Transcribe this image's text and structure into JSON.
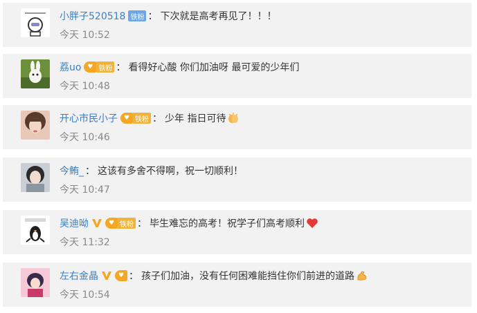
{
  "comments": [
    {
      "name": "小胖子520518",
      "badge_label": "铁粉",
      "badge_style": "blue",
      "text": "下次就是高考再见了！！！",
      "time": "今天 10:52"
    },
    {
      "name": "荔uo",
      "badge_label": "铁粉",
      "badge_style": "gold",
      "text": "看得好心酸 你们加油呀 最可爱的少年们",
      "time": "今天 10:48"
    },
    {
      "name": "开心市民小子",
      "badge_label": "铁粉",
      "badge_style": "gold",
      "text": "少年 指日可待",
      "emoji": "clap-hands-emoji",
      "time": "今天 10:46"
    },
    {
      "name": "今鲔_",
      "text": "这该有多舍不得啊，祝一切顺利！",
      "time": "今天 10:47"
    },
    {
      "name": "吴迪呦",
      "verified": true,
      "badge_label": "铁粉",
      "badge_style": "gold",
      "text": "毕生难忘的高考！祝学子们高考顺利",
      "emoji": "red-heart-emoji",
      "time": "今天 11:32"
    },
    {
      "name": "左右金晶",
      "verified": true,
      "badge_label": "",
      "badge_style": "gold",
      "text": "孩子们加油，没有任何困难能挡住你们前进的道路",
      "emoji": "flexed-biceps-emoji",
      "time": "今天 10:54"
    }
  ],
  "colors": {
    "name": "#3a7fc4",
    "row_bg": "#f2f2f2",
    "time": "#888888",
    "verified": "#f5a623",
    "fan_blue": "#6aa6e8",
    "fan_gold": "#f0b43c"
  }
}
